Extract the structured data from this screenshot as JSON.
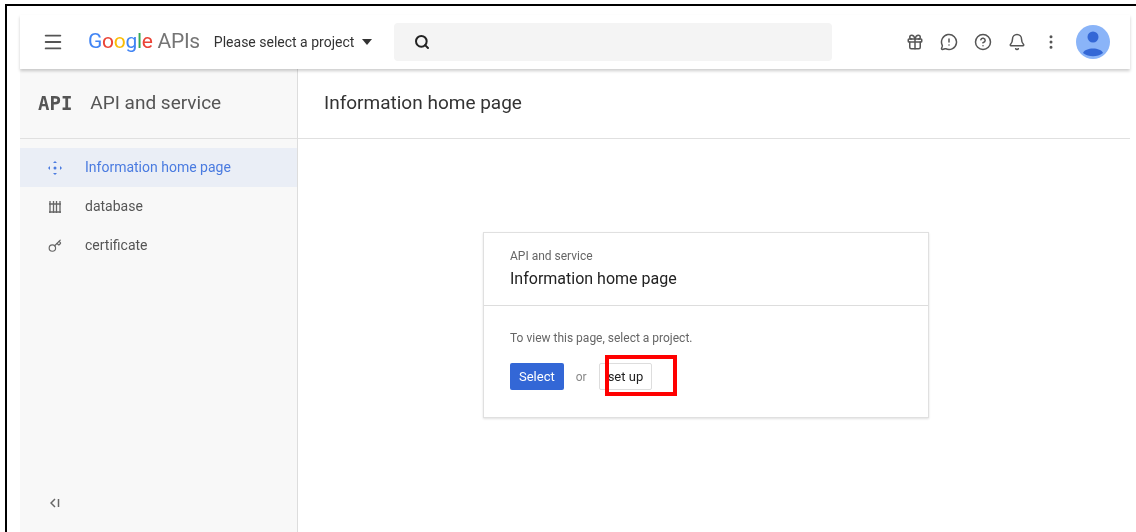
{
  "header": {
    "logo_brand": "Google",
    "logo_product": "APIs",
    "project_picker": "Please select a project"
  },
  "sidebar": {
    "badge": "API",
    "title": "API and service",
    "items": [
      {
        "label": "Information home page",
        "kind": "home",
        "selected": true
      },
      {
        "label": "database",
        "kind": "database",
        "selected": false
      },
      {
        "label": "certificate",
        "kind": "key",
        "selected": false
      }
    ]
  },
  "main": {
    "title": "Information home page"
  },
  "card": {
    "eyebrow": "API and service",
    "title": "Information home page",
    "message": "To view this page, select a project.",
    "primary_button": "Select",
    "separator": "or",
    "secondary_button": "set up",
    "secondary_highlighted": true
  }
}
